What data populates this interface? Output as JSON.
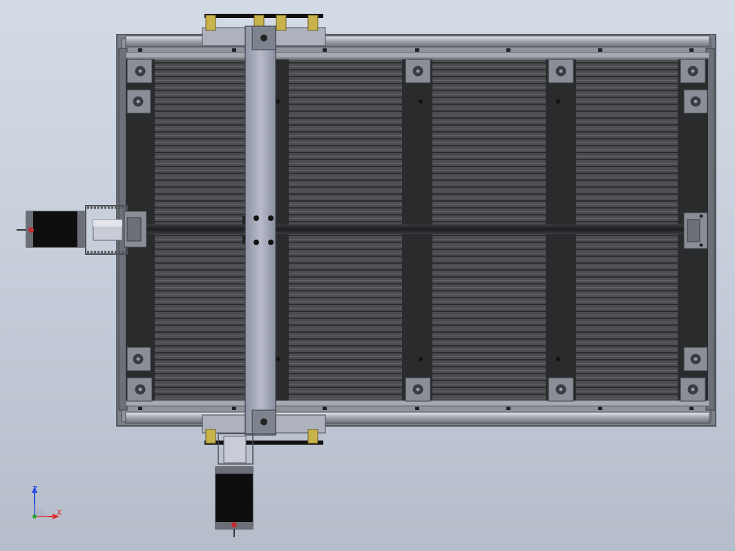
{
  "viewport": {
    "background": "gradient-blue-gray",
    "model": "cnc-router-top-view"
  },
  "colors": {
    "frame": "#8d9198",
    "frame_dark": "#5b5f66",
    "slat": "#4a4c50",
    "slat_dark": "#2f3033",
    "gantry": "#a9aebf",
    "motor": "#111111",
    "brass": "#c8b24a",
    "axis_x": "#e03030",
    "axis_y": "#30a030",
    "axis_z": "#3050e0"
  },
  "triad": {
    "x_label": "X",
    "z_label": "Z",
    "icon": "coordinate-triad-icon"
  }
}
